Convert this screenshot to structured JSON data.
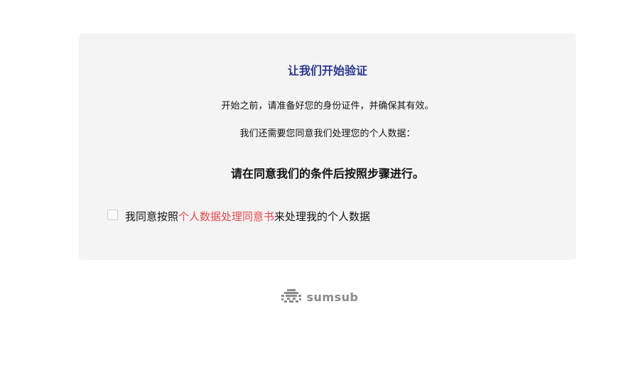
{
  "card": {
    "title": "让我们开始验证",
    "intro": "开始之前，请准备好您的身份证件，并确保其有效。",
    "consent_prompt": "我们还需要您同意我们处理您的个人数据：",
    "instruction": "请在同意我们的条件后按照步骤进行。",
    "consent": {
      "checked": false,
      "text_before": "我同意按照",
      "link_text": "个人数据处理同意书",
      "text_after": "来处理我的个人数据"
    }
  },
  "footer": {
    "brand": "sumsub",
    "logo_icon": "sumsub-logo-icon"
  },
  "colors": {
    "title": "#2b3990",
    "link": "#e5484d",
    "card_bg": "#f4f4f4",
    "brand": "#8a8a8a"
  }
}
